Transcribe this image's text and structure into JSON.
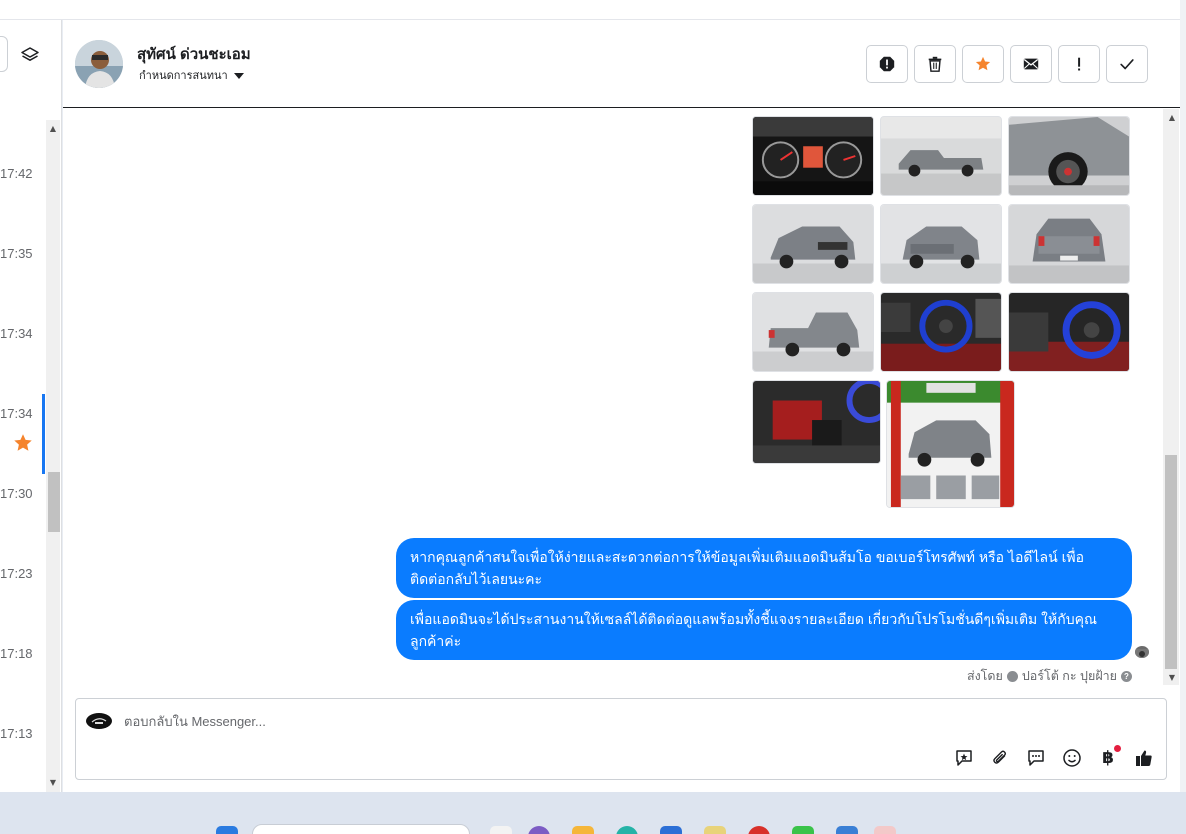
{
  "conversation_list": {
    "times": [
      "17:42",
      "17:35",
      "17:34",
      "17:34",
      "17:30",
      "17:23",
      "17:18",
      "17:13"
    ],
    "starred_row_index": 3
  },
  "header": {
    "contact_name": "สุทัศน์ ด่วนชะเอม",
    "assign_label": "กำหนดการสนทนา",
    "actions": [
      "spam-icon",
      "trash-icon",
      "star-icon",
      "mail-icon",
      "follow-up-icon",
      "check-icon"
    ]
  },
  "messages": [
    "หากคุณลูกค้าสนใจเพื่อให้ง่ายและสะดวกต่อการให้ข้อมูลเพิ่มเติมแอดมินส้มโอ ขอเบอร์โทรศัพท์ หรือ ไอดีไลน์ เพื่อติดต่อกลับไว้เลยนะคะ",
    "เพื่อแอดมินจะได้ประสานงานให้เซลล์ได้ติดต่อดูแลพร้อมทั้งชี้แจงรายละเอียด เกี่ยวกับโปรโมชั่นดีๆเพิ่มเติม ให้กับคุณลูกค้าค่ะ"
  ],
  "sent_by": {
    "prefix": "ส่งโดย",
    "name": "ปอร์โต้ กะ ปุยฝ้าย"
  },
  "composer": {
    "placeholder": "ตอบกลับใน Messenger..."
  },
  "colors": {
    "bubble": "#0a7cff",
    "star": "#f5842d",
    "selection": "#1877f2"
  }
}
